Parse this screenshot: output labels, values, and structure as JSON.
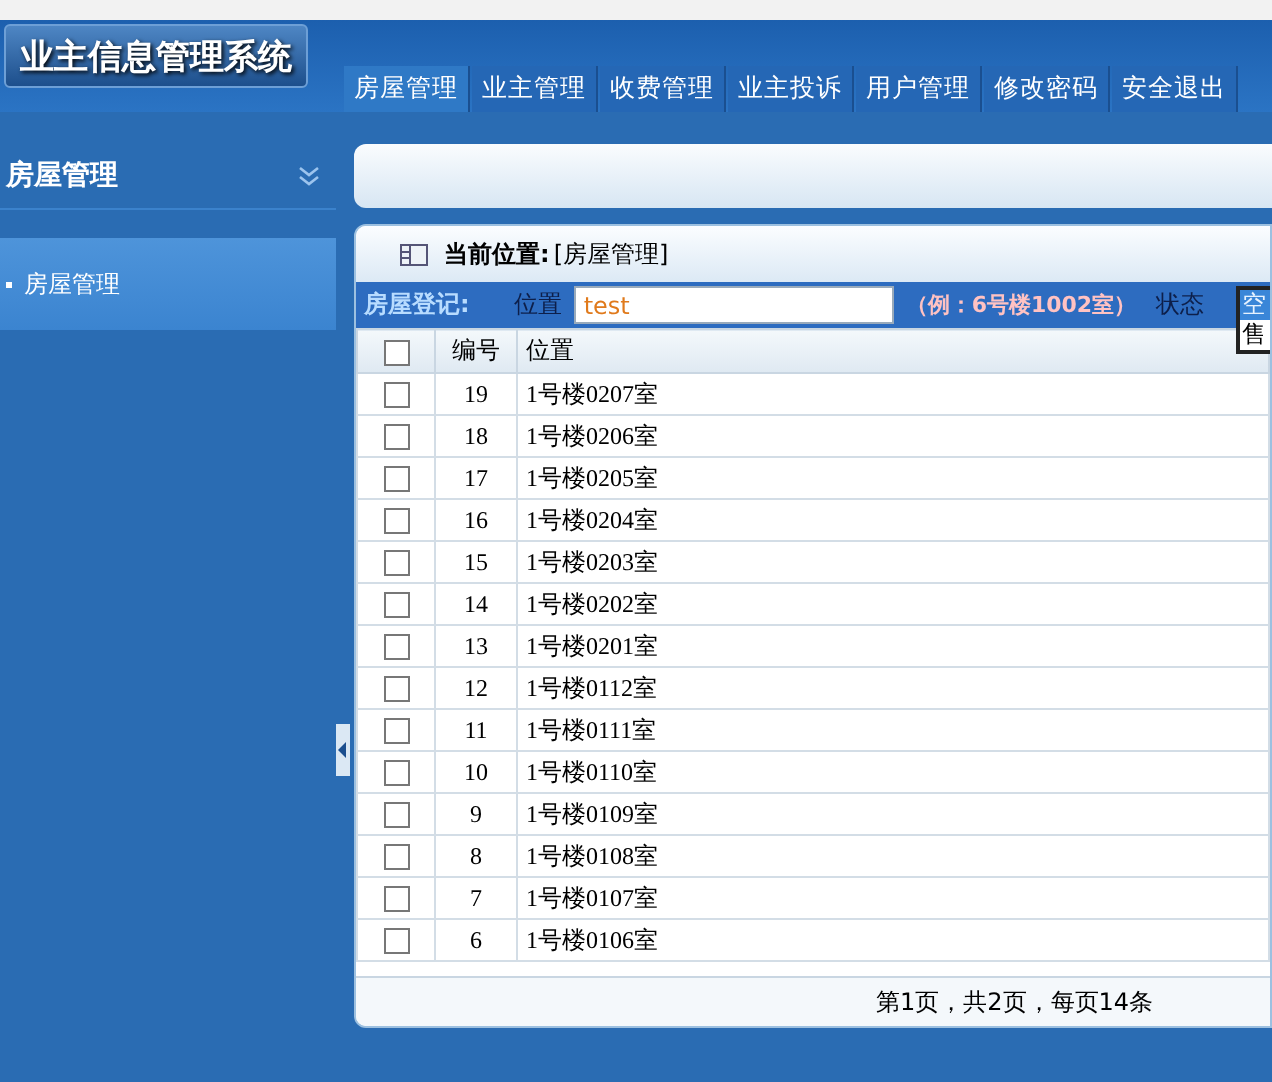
{
  "logo": "业主信息管理系统",
  "nav": [
    {
      "label": "房屋管理",
      "selected": true
    },
    {
      "label": "业主管理",
      "selected": false
    },
    {
      "label": "收费管理",
      "selected": false
    },
    {
      "label": "业主投诉",
      "selected": false
    },
    {
      "label": "用户管理",
      "selected": false
    },
    {
      "label": "修改密码",
      "selected": false
    },
    {
      "label": "安全退出",
      "selected": false
    }
  ],
  "sidebar": {
    "title": "房屋管理",
    "items": [
      {
        "label": "房屋管理",
        "selected": true
      }
    ]
  },
  "breadcrumb": {
    "label": "当前位置:",
    "value": "[房屋管理]"
  },
  "search": {
    "title": "房屋登记:",
    "location_label": "位置",
    "location_value": "test",
    "hint": "（例：6号楼1002室）",
    "status_label": "状态",
    "status_options": [
      {
        "label": "空",
        "selected": true
      },
      {
        "label": "售",
        "selected": false
      }
    ]
  },
  "table": {
    "select_all": false,
    "columns": [
      "编号",
      "位置"
    ],
    "rows": [
      {
        "id": "19",
        "location": "1号楼0207室",
        "checked": false
      },
      {
        "id": "18",
        "location": "1号楼0206室",
        "checked": false
      },
      {
        "id": "17",
        "location": "1号楼0205室",
        "checked": false
      },
      {
        "id": "16",
        "location": "1号楼0204室",
        "checked": false
      },
      {
        "id": "15",
        "location": "1号楼0203室",
        "checked": false
      },
      {
        "id": "14",
        "location": "1号楼0202室",
        "checked": false
      },
      {
        "id": "13",
        "location": "1号楼0201室",
        "checked": false
      },
      {
        "id": "12",
        "location": "1号楼0112室",
        "checked": false
      },
      {
        "id": "11",
        "location": "1号楼0111室",
        "checked": false
      },
      {
        "id": "10",
        "location": "1号楼0110室",
        "checked": false
      },
      {
        "id": "9",
        "location": "1号楼0109室",
        "checked": false
      },
      {
        "id": "8",
        "location": "1号楼0108室",
        "checked": false
      },
      {
        "id": "7",
        "location": "1号楼0107室",
        "checked": false
      },
      {
        "id": "6",
        "location": "1号楼0106室",
        "checked": false
      }
    ]
  },
  "pagination": "第1页，共2页，每页14条"
}
